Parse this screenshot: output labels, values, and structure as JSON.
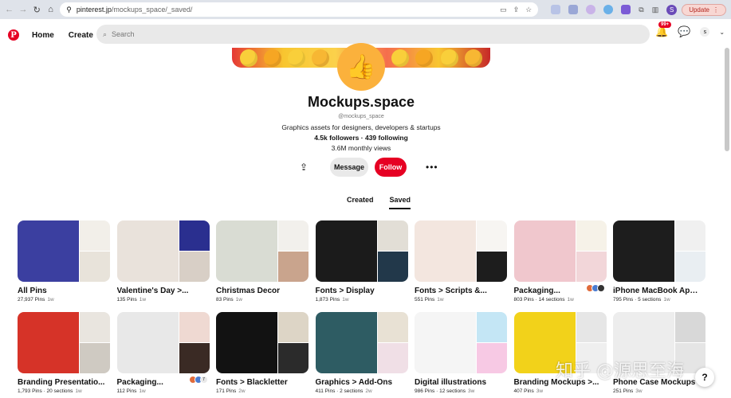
{
  "browser": {
    "url_host": "pinterest.jp",
    "url_path": "/mockups_space/_saved/",
    "profile_initial": "S",
    "update_label": "Update",
    "icons": [
      "back-icon",
      "forward-icon",
      "reload-icon",
      "home-icon",
      "site-info-icon",
      "screen-cast-icon",
      "share-icon",
      "bookmark-star-icon",
      "extensions-icon",
      "sidebar-icon"
    ]
  },
  "header": {
    "logo": "P",
    "home_label": "Home",
    "create_label": "Create",
    "search_placeholder": "Search",
    "notifications_badge": "99+",
    "user_initial": "s"
  },
  "profile": {
    "name": "Mockups.space",
    "handle": "@mockups_space",
    "bio": "Graphics assets for designers, developers & startups",
    "followers": "4.5k followers",
    "following": "439 following",
    "monthly_views": "3.6M monthly views",
    "message_label": "Message",
    "follow_label": "Follow",
    "accent_color": "#e60023"
  },
  "tabs": [
    {
      "label": "Created",
      "active": false
    },
    {
      "label": "Saved",
      "active": true
    }
  ],
  "boards": [
    {
      "title": "All Pins",
      "pins": "27,937 Pins",
      "sections": "",
      "ago": "1w",
      "colors": [
        "#3b3fa0",
        "#f2efe9",
        "#e8e3da"
      ]
    },
    {
      "title": "Valentine's Day >...",
      "pins": "135 Pins",
      "sections": "",
      "ago": "1w",
      "colors": [
        "#e9e2db",
        "#2a2f8f",
        "#d8cfc6"
      ]
    },
    {
      "title": "Christmas Decor",
      "pins": "83 Pins",
      "sections": "",
      "ago": "1w",
      "colors": [
        "#d9dcd3",
        "#f2f0ec",
        "#c9a48d"
      ]
    },
    {
      "title": "Fonts > Display",
      "pins": "1,873 Pins",
      "sections": "",
      "ago": "1w",
      "colors": [
        "#1b1b1b",
        "#e2ded6",
        "#22384a"
      ]
    },
    {
      "title": "Fonts > Scripts &...",
      "pins": "551 Pins",
      "sections": "",
      "ago": "1w",
      "colors": [
        "#f3e6df",
        "#f7f5f2",
        "#1d1d1d"
      ]
    },
    {
      "title": "Packaging...",
      "pins": "803 Pins",
      "sections": "14 sections",
      "ago": "1w",
      "colors": [
        "#f0c7cd",
        "#f6f2e8",
        "#f2d6d9"
      ]
    },
    {
      "title": "iPhone MacBook Appl...",
      "pins": "795 Pins",
      "sections": "5 sections",
      "ago": "1w",
      "colors": [
        "#1d1d1d",
        "#f0f0f0",
        "#e9eef2"
      ]
    },
    {
      "title": "Branding Presentatio...",
      "pins": "1,793 Pins",
      "sections": "20 sections",
      "ago": "1w",
      "colors": [
        "#d63328",
        "#e9e5df",
        "#cfcac2"
      ]
    },
    {
      "title": "Packaging...",
      "pins": "112 Pins",
      "sections": "",
      "ago": "1w",
      "colors": [
        "#e8e8e8",
        "#efd9d2",
        "#3a2a24"
      ]
    },
    {
      "title": "Fonts > Blackletter",
      "pins": "171 Pins",
      "sections": "",
      "ago": "2w",
      "colors": [
        "#121212",
        "#ddd5c6",
        "#2b2b2b"
      ]
    },
    {
      "title": "Graphics > Add-Ons",
      "pins": "411 Pins",
      "sections": "2 sections",
      "ago": "2w",
      "colors": [
        "#2e5c63",
        "#e8e1d4",
        "#f0dfe6"
      ]
    },
    {
      "title": "Digital illustrations",
      "pins": "986 Pins",
      "sections": "12 sections",
      "ago": "3w",
      "colors": [
        "#f5f5f5",
        "#c4e6f5",
        "#f7c9e4"
      ]
    },
    {
      "title": "Branding Mockups >...",
      "pins": "407 Pins",
      "sections": "",
      "ago": "3w",
      "colors": [
        "#f2d21a",
        "#e6e6e6",
        "#efefef"
      ]
    },
    {
      "title": "Phone Case Mockups",
      "pins": "251 Pins",
      "sections": "",
      "ago": "3w",
      "colors": [
        "#ededed",
        "#d8d8d8",
        "#e5e5e5"
      ]
    }
  ],
  "collab_count": "7",
  "watermark": "知乎 @源思至海",
  "help_label": "?"
}
